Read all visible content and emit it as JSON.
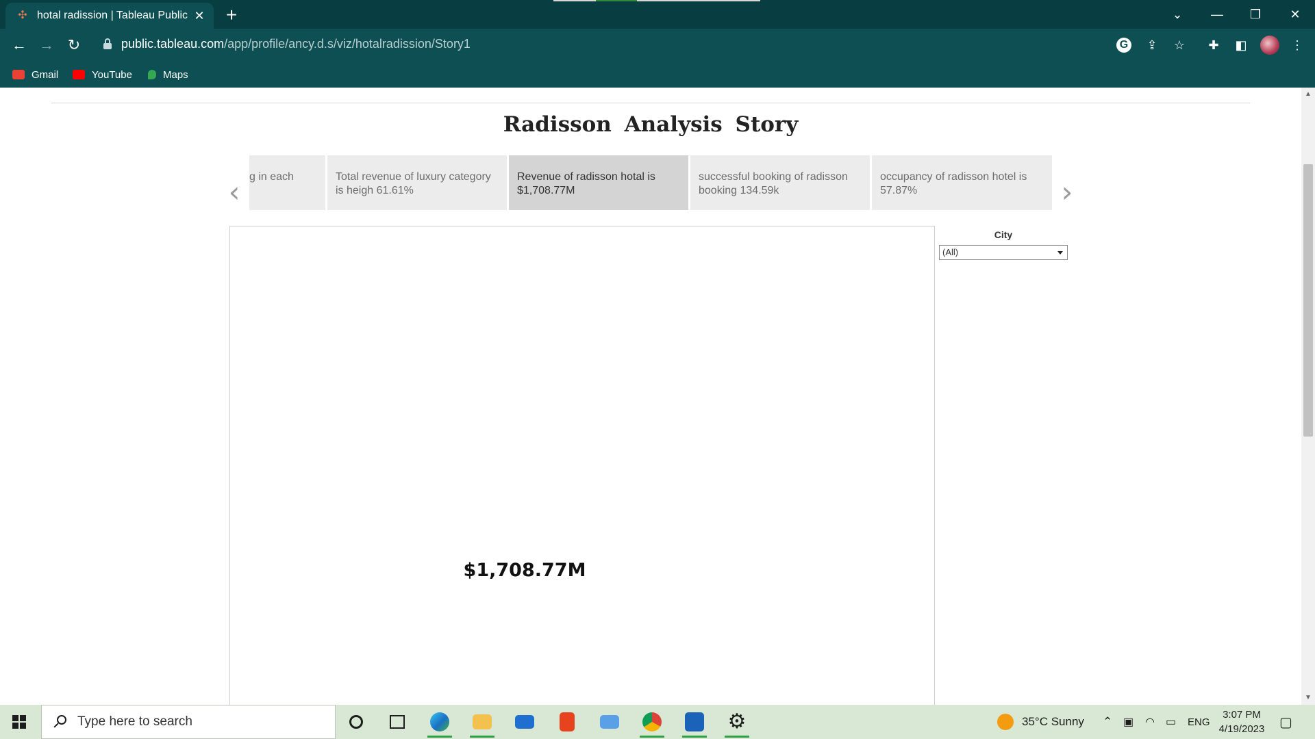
{
  "browser": {
    "tab_title": "hotal radission | Tableau Public",
    "tab_close": "✕",
    "new_tab": "+",
    "url_host": "public.tableau.com",
    "url_path": "/app/profile/ancy.d.s/viz/hotalradission/Story1",
    "bookmarks": [
      {
        "label": "Gmail",
        "icon": "gmail-icon",
        "color": "#ea4335"
      },
      {
        "label": "YouTube",
        "icon": "youtube-icon",
        "color": "#ff0000"
      },
      {
        "label": "Maps",
        "icon": "maps-icon",
        "color": "#34a853"
      }
    ]
  },
  "story": {
    "title": "Radisson  Analysis  Story",
    "points": [
      {
        "text": "g in each"
      },
      {
        "text": "Total revenue of luxury category is heigh 61.61%"
      },
      {
        "text": "Revenue of radisson hotal is $1,708.77M"
      },
      {
        "text": "successful booking of radisson booking 134.59k"
      },
      {
        "text": "occupancy of radisson hotel is 57.87%"
      }
    ],
    "active_point_index": 2,
    "prev_arrow": "‹",
    "next_arrow": "›",
    "kpi_value": "$1,708.77M",
    "filter": {
      "label": "City",
      "selected": "(All)"
    }
  },
  "taskbar": {
    "search_placeholder": "Type here to search",
    "weather": "35°C  Sunny",
    "language": "ENG",
    "time": "3:07 PM",
    "date": "4/19/2023"
  },
  "colors": {
    "chrome_bg": "#0d4f52",
    "tabstrip_bg": "#083d41",
    "story_point_bg": "#ececec",
    "story_point_active_bg": "#d4d4d4",
    "taskbar_bg": "#d8e8d4"
  }
}
